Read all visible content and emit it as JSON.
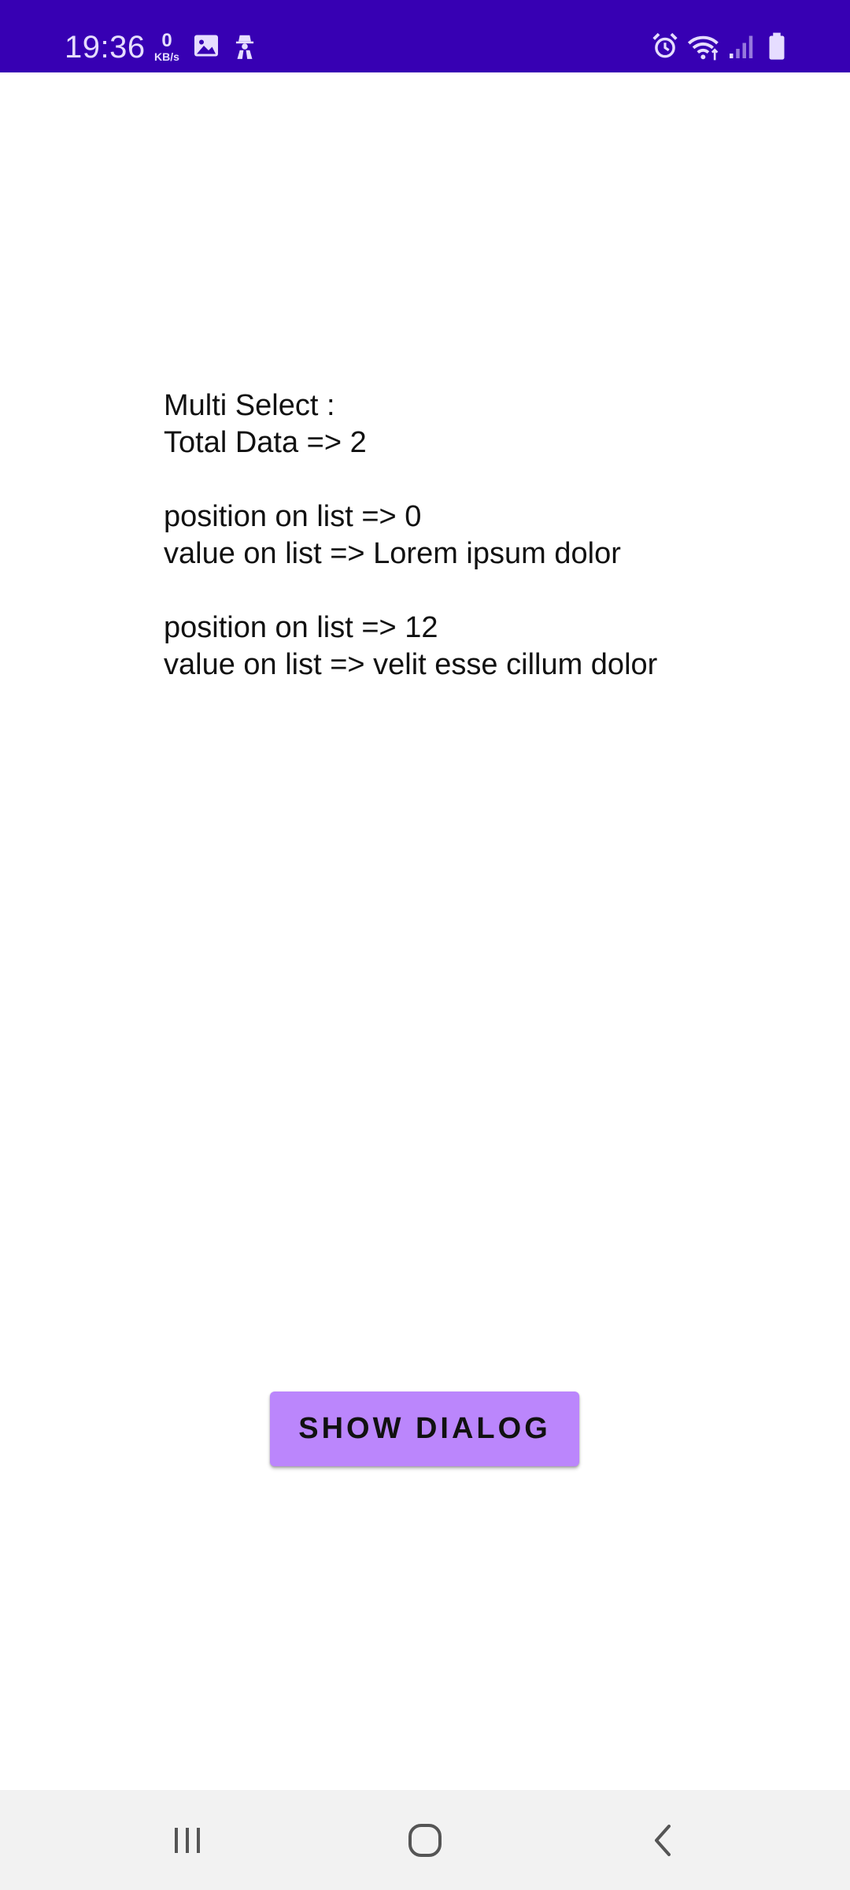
{
  "status_bar": {
    "time": "19:36",
    "data_speed_value": "0",
    "data_speed_unit": "KB/s",
    "left_icons": [
      "image-icon",
      "incognito-icon"
    ],
    "right_icons": [
      "alarm-icon",
      "wifi-icon",
      "signal-icon",
      "battery-icon"
    ],
    "background_color": "#3700B3"
  },
  "content": {
    "heading": "Multi Select :",
    "total": "Total Data => 2",
    "items": [
      {
        "position": "position on list => 0",
        "value": "value on list => Lorem ipsum dolor"
      },
      {
        "position": "position on list => 12",
        "value": "value on list => velit esse cillum dolor"
      }
    ]
  },
  "button": {
    "label": "SHOW DIALOG",
    "color": "#BB86FC"
  },
  "nav_bar": {
    "buttons": [
      "recents-icon",
      "home-icon",
      "back-icon"
    ]
  }
}
